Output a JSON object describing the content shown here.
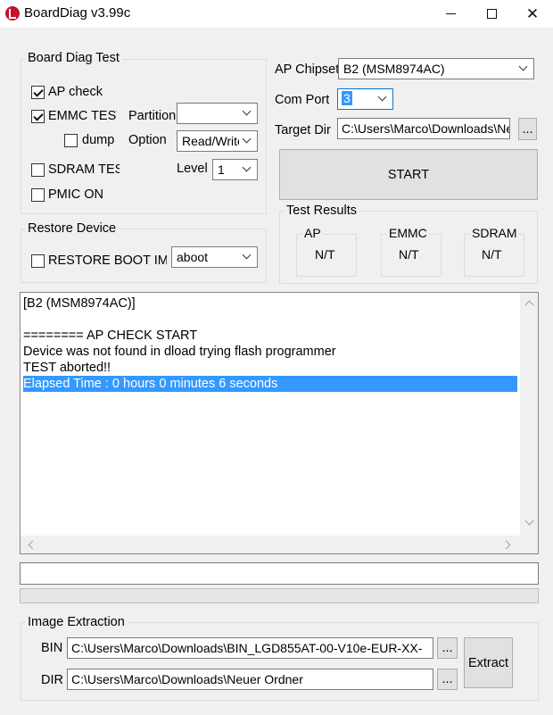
{
  "window": {
    "title": "BoardDiag v3.99c"
  },
  "board_diag": {
    "group_label": "Board Diag Test",
    "ap_check": {
      "label": "AP check",
      "checked": true
    },
    "emmc_test": {
      "label": "EMMC TEST",
      "checked": true
    },
    "dump": {
      "label": "dump",
      "checked": false
    },
    "sdram_test": {
      "label": "SDRAM TEST",
      "checked": false
    },
    "pmic_on": {
      "label": "PMIC ON",
      "checked": false
    },
    "partition_label": "Partition",
    "partition_value": "",
    "option_label": "Option",
    "option_value": "Read/Write",
    "level_label": "Level",
    "level_value": "1"
  },
  "restore": {
    "group_label": "Restore Device",
    "restore_boot": {
      "label": "RESTORE BOOT IMG",
      "checked": false
    },
    "image_value": "aboot"
  },
  "config": {
    "ap_chipset_label": "AP Chipset",
    "ap_chipset_value": "B2 (MSM8974AC)",
    "com_port_label": "Com Port",
    "com_port_value": "3",
    "target_dir_label": "Target Dir",
    "target_dir_value": "C:\\Users\\Marco\\Downloads\\Neuer Ordner",
    "browse_label": "...",
    "start_label": "START"
  },
  "results": {
    "group_label": "Test Results",
    "items": [
      {
        "name": "AP",
        "value": "N/T"
      },
      {
        "name": "EMMC",
        "value": "N/T"
      },
      {
        "name": "SDRAM",
        "value": "N/T"
      }
    ]
  },
  "log": {
    "lines": [
      {
        "text": "[B2 (MSM8974AC)]",
        "selected": false
      },
      {
        "text": "",
        "selected": false
      },
      {
        "text": "======== AP CHECK START",
        "selected": false
      },
      {
        "text": "Device was not found in dload trying flash programmer",
        "selected": false
      },
      {
        "text": "TEST aborted!!",
        "selected": false
      },
      {
        "text": "Elapsed Time : 0 hours 0 minutes 6 seconds",
        "selected": true
      }
    ]
  },
  "status_input_value": "",
  "progress_percent": 0,
  "image_extraction": {
    "group_label": "Image Extraction",
    "bin_label": "BIN",
    "bin_value": "C:\\Users\\Marco\\Downloads\\BIN_LGD855AT-00-V10e-EUR-XX-",
    "dir_label": "DIR",
    "dir_value": "C:\\Users\\Marco\\Downloads\\Neuer Ordner",
    "browse_label": "...",
    "extract_label": "Extract"
  },
  "colors": {
    "selection": "#3399ff",
    "app_icon": "#c8102e",
    "window_bg": "#f0f0f0"
  }
}
